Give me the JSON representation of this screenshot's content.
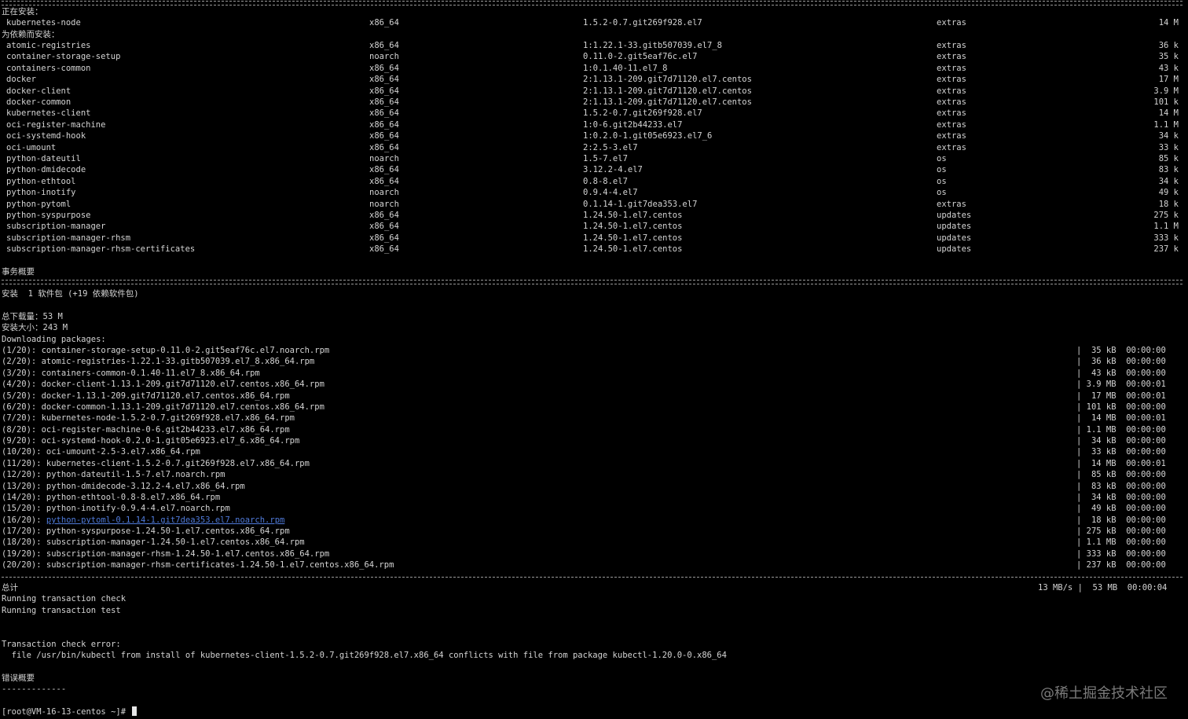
{
  "header_installing": "正在安装：",
  "header_deps": "为依赖而安装：",
  "main_pkg": {
    "name": "kubernetes-node",
    "arch": "x86_64",
    "version": "1.5.2-0.7.git269f928.el7",
    "repo": "extras",
    "size": "14 M"
  },
  "deps": [
    {
      "name": "atomic-registries",
      "arch": "x86_64",
      "version": "1:1.22.1-33.gitb507039.el7_8",
      "repo": "extras",
      "size": "36 k"
    },
    {
      "name": "container-storage-setup",
      "arch": "noarch",
      "version": "0.11.0-2.git5eaf76c.el7",
      "repo": "extras",
      "size": "35 k"
    },
    {
      "name": "containers-common",
      "arch": "x86_64",
      "version": "1:0.1.40-11.el7_8",
      "repo": "extras",
      "size": "43 k"
    },
    {
      "name": "docker",
      "arch": "x86_64",
      "version": "2:1.13.1-209.git7d71120.el7.centos",
      "repo": "extras",
      "size": "17 M"
    },
    {
      "name": "docker-client",
      "arch": "x86_64",
      "version": "2:1.13.1-209.git7d71120.el7.centos",
      "repo": "extras",
      "size": "3.9 M"
    },
    {
      "name": "docker-common",
      "arch": "x86_64",
      "version": "2:1.13.1-209.git7d71120.el7.centos",
      "repo": "extras",
      "size": "101 k"
    },
    {
      "name": "kubernetes-client",
      "arch": "x86_64",
      "version": "1.5.2-0.7.git269f928.el7",
      "repo": "extras",
      "size": "14 M"
    },
    {
      "name": "oci-register-machine",
      "arch": "x86_64",
      "version": "1:0-6.git2b44233.el7",
      "repo": "extras",
      "size": "1.1 M"
    },
    {
      "name": "oci-systemd-hook",
      "arch": "x86_64",
      "version": "1:0.2.0-1.git05e6923.el7_6",
      "repo": "extras",
      "size": "34 k"
    },
    {
      "name": "oci-umount",
      "arch": "x86_64",
      "version": "2:2.5-3.el7",
      "repo": "extras",
      "size": "33 k"
    },
    {
      "name": "python-dateutil",
      "arch": "noarch",
      "version": "1.5-7.el7",
      "repo": "os",
      "size": "85 k"
    },
    {
      "name": "python-dmidecode",
      "arch": "x86_64",
      "version": "3.12.2-4.el7",
      "repo": "os",
      "size": "83 k"
    },
    {
      "name": "python-ethtool",
      "arch": "x86_64",
      "version": "0.8-8.el7",
      "repo": "os",
      "size": "34 k"
    },
    {
      "name": "python-inotify",
      "arch": "noarch",
      "version": "0.9.4-4.el7",
      "repo": "os",
      "size": "49 k"
    },
    {
      "name": "python-pytoml",
      "arch": "noarch",
      "version": "0.1.14-1.git7dea353.el7",
      "repo": "extras",
      "size": "18 k"
    },
    {
      "name": "python-syspurpose",
      "arch": "x86_64",
      "version": "1.24.50-1.el7.centos",
      "repo": "updates",
      "size": "275 k"
    },
    {
      "name": "subscription-manager",
      "arch": "x86_64",
      "version": "1.24.50-1.el7.centos",
      "repo": "updates",
      "size": "1.1 M"
    },
    {
      "name": "subscription-manager-rhsm",
      "arch": "x86_64",
      "version": "1.24.50-1.el7.centos",
      "repo": "updates",
      "size": "333 k"
    },
    {
      "name": "subscription-manager-rhsm-certificates",
      "arch": "x86_64",
      "version": "1.24.50-1.el7.centos",
      "repo": "updates",
      "size": "237 k"
    }
  ],
  "summary_title": "事务概要",
  "install_summary": "安装  1 软件包 (+19 依赖软件包)",
  "total_download": "总下载量：53 M",
  "install_size": "安装大小：243 M",
  "downloading": "Downloading packages:",
  "downloads": [
    {
      "file": "(1/20): container-storage-setup-0.11.0-2.git5eaf76c.el7.noarch.rpm",
      "stat": "|  35 kB  00:00:00"
    },
    {
      "file": "(2/20): atomic-registries-1.22.1-33.gitb507039.el7_8.x86_64.rpm",
      "stat": "|  36 kB  00:00:00"
    },
    {
      "file": "(3/20): containers-common-0.1.40-11.el7_8.x86_64.rpm",
      "stat": "|  43 kB  00:00:00"
    },
    {
      "file": "(4/20): docker-client-1.13.1-209.git7d71120.el7.centos.x86_64.rpm",
      "stat": "| 3.9 MB  00:00:01"
    },
    {
      "file": "(5/20): docker-1.13.1-209.git7d71120.el7.centos.x86_64.rpm",
      "stat": "|  17 MB  00:00:01"
    },
    {
      "file": "(6/20): docker-common-1.13.1-209.git7d71120.el7.centos.x86_64.rpm",
      "stat": "| 101 kB  00:00:00"
    },
    {
      "file": "(7/20): kubernetes-node-1.5.2-0.7.git269f928.el7.x86_64.rpm",
      "stat": "|  14 MB  00:00:01"
    },
    {
      "file": "(8/20): oci-register-machine-0-6.git2b44233.el7.x86_64.rpm",
      "stat": "| 1.1 MB  00:00:00"
    },
    {
      "file": "(9/20): oci-systemd-hook-0.2.0-1.git05e6923.el7_6.x86_64.rpm",
      "stat": "|  34 kB  00:00:00"
    },
    {
      "file": "(10/20): oci-umount-2.5-3.el7.x86_64.rpm",
      "stat": "|  33 kB  00:00:00"
    },
    {
      "file": "(11/20): kubernetes-client-1.5.2-0.7.git269f928.el7.x86_64.rpm",
      "stat": "|  14 MB  00:00:01"
    },
    {
      "file": "(12/20): python-dateutil-1.5-7.el7.noarch.rpm",
      "stat": "|  85 kB  00:00:00"
    },
    {
      "file": "(13/20): python-dmidecode-3.12.2-4.el7.x86_64.rpm",
      "stat": "|  83 kB  00:00:00"
    },
    {
      "file": "(14/20): python-ethtool-0.8-8.el7.x86_64.rpm",
      "stat": "|  34 kB  00:00:00"
    },
    {
      "file": "(15/20): python-inotify-0.9.4-4.el7.noarch.rpm",
      "stat": "|  49 kB  00:00:00"
    },
    {
      "file": "(16/20): ",
      "link": "python-pytoml-0.1.14-1.git7dea353.el7.noarch.rpm",
      "stat": "|  18 kB  00:00:00"
    },
    {
      "file": "(17/20): python-syspurpose-1.24.50-1.el7.centos.x86_64.rpm",
      "stat": "| 275 kB  00:00:00"
    },
    {
      "file": "(18/20): subscription-manager-1.24.50-1.el7.centos.x86_64.rpm",
      "stat": "| 1.1 MB  00:00:00"
    },
    {
      "file": "(19/20): subscription-manager-rhsm-1.24.50-1.el7.centos.x86_64.rpm",
      "stat": "| 333 kB  00:00:00"
    },
    {
      "file": "(20/20): subscription-manager-rhsm-certificates-1.24.50-1.el7.centos.x86_64.rpm",
      "stat": "| 237 kB  00:00:00"
    }
  ],
  "total_label": "总计",
  "total_stat": "13 MB/s |  53 MB  00:00:04",
  "check_line": "Running transaction check",
  "test_line": "Running transaction test",
  "error_title": "Transaction check error:",
  "error_detail": "  file /usr/bin/kubectl from install of kubernetes-client-1.5.2-0.7.git269f928.el7.x86_64 conflicts with file from package kubectl-1.20.0-0.x86_64",
  "error_summary": "错误概要",
  "error_summary_rule": "-------------",
  "prompt": "[root@VM-16-13-centos ~]# ",
  "watermark": "@稀土掘金技术社区"
}
